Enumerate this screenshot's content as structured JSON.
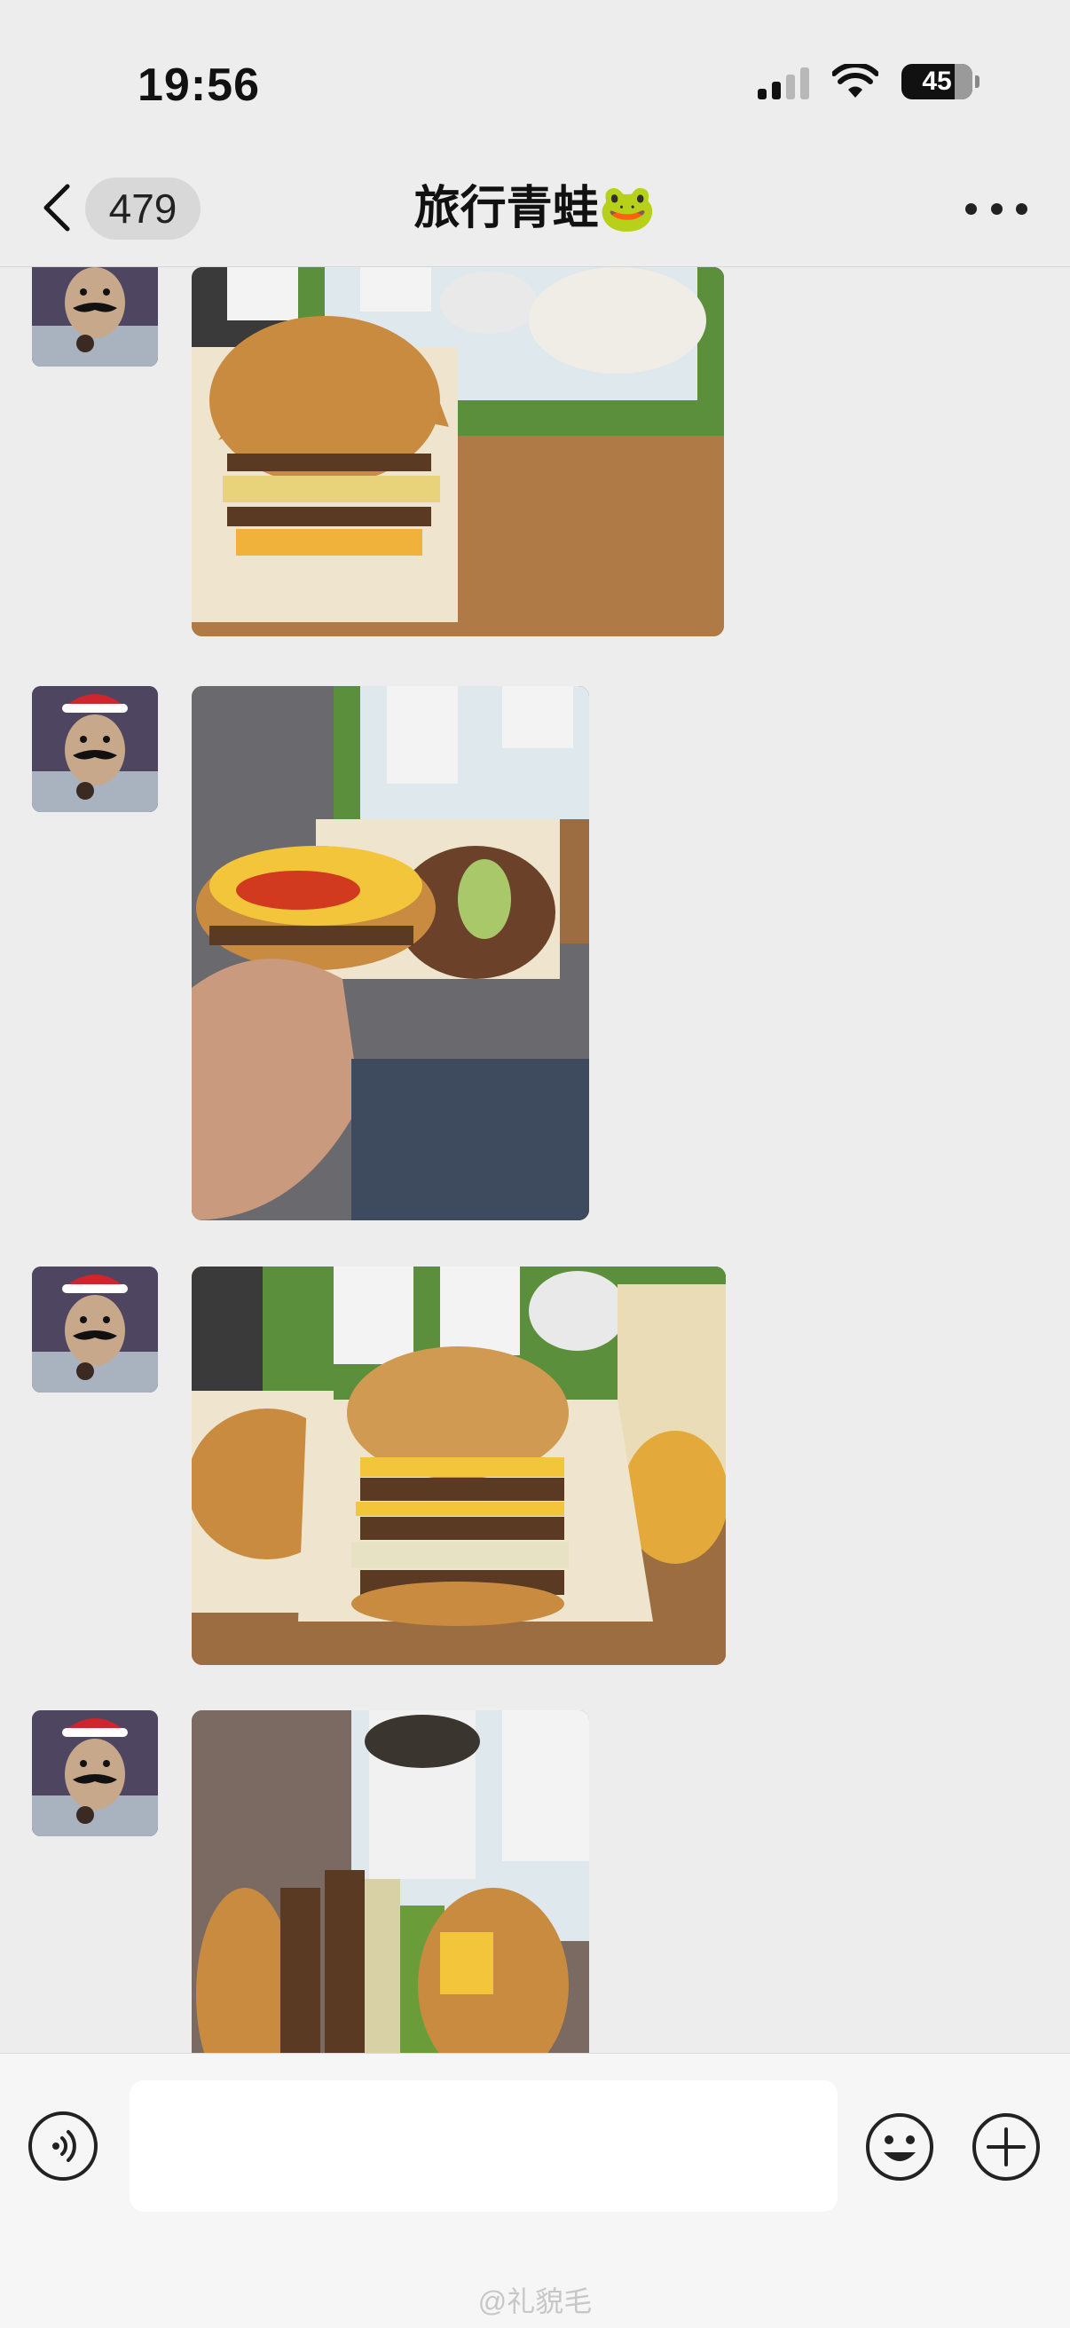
{
  "status_bar": {
    "time": "19:56",
    "battery_level": "45",
    "signal_bars_on": 2,
    "signal_bars_total": 4
  },
  "header": {
    "back_count": "479",
    "title": "旅行青蛙🐸"
  },
  "messages": [
    {
      "type": "image",
      "description_icon": "photo-burger-tray"
    },
    {
      "type": "image",
      "description_icon": "photo-burger-in-hand"
    },
    {
      "type": "image",
      "description_icon": "photo-triple-burger"
    },
    {
      "type": "image",
      "description_icon": "photo-burger-side"
    }
  ],
  "input": {
    "placeholder": ""
  },
  "watermark": "@礼貌毛"
}
